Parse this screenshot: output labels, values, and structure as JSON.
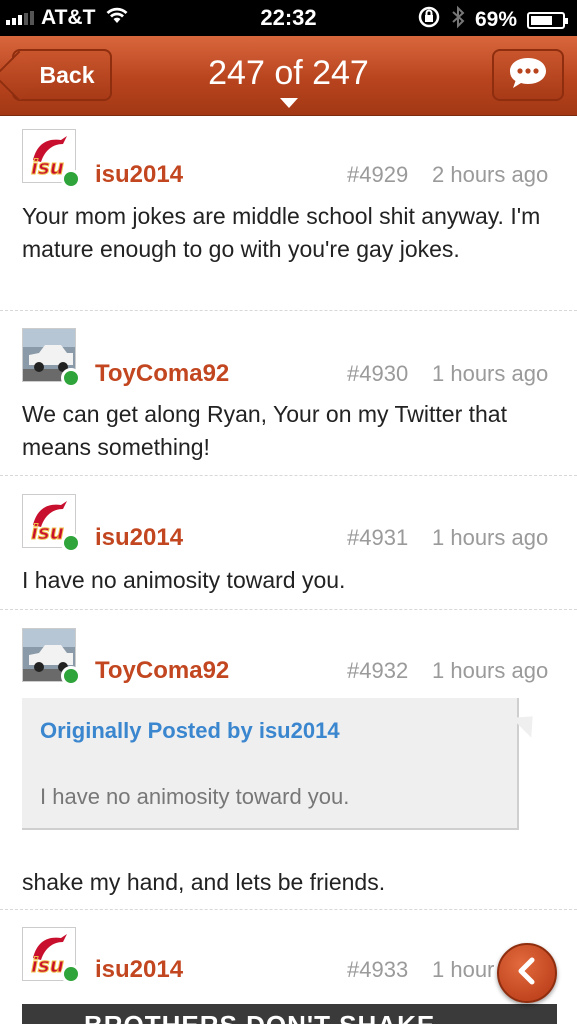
{
  "status": {
    "carrier": "AT&T",
    "time": "22:32",
    "battery": "69%",
    "battery_level": 0.69
  },
  "nav": {
    "back_label": "Back",
    "title": "247 of 247"
  },
  "posts": [
    {
      "user": "isu2014",
      "num": "#4929",
      "time": "2 hours ago",
      "text": "Your mom jokes are middle school shit anyway. I'm mature enough to go with you're gay jokes.",
      "avatar": "isu-logo"
    },
    {
      "user": "ToyComa92",
      "num": "#4930",
      "time": "1 hours ago",
      "text": "We can get along Ryan, Your on my Twitter that means something!",
      "avatar": "truck-photo"
    },
    {
      "user": "isu2014",
      "num": "#4931",
      "time": "1 hours ago",
      "text": "I have no animosity toward you.",
      "avatar": "isu-logo"
    },
    {
      "user": "ToyComa92",
      "num": "#4932",
      "time": "1 hours ago",
      "quote_header": "Originally Posted by isu2014",
      "quote_text": "I have no animosity toward you.",
      "text": "shake my hand, and lets be friends.",
      "avatar": "truck-photo"
    },
    {
      "user": "isu2014",
      "num": "#4933",
      "time": "1 hour",
      "avatar": "isu-logo",
      "image_caption": "BROTHERS DON'T SHAKE"
    }
  ],
  "icons": {
    "reply": "chat-bubble-icon",
    "scroll_back": "chevron-left-icon"
  },
  "colors": {
    "accent": "#c2461f",
    "online": "#2ea43a",
    "quote_link": "#3a86cf"
  }
}
